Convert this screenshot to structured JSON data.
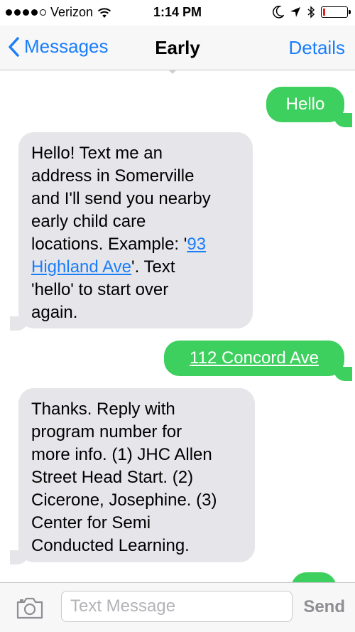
{
  "status_bar": {
    "carrier": "Verizon",
    "time": "1:14 PM",
    "signal_bars": 4,
    "battery_level": 0.1
  },
  "nav": {
    "back_label": "Messages",
    "title": "Early",
    "details_label": "Details"
  },
  "messages": {
    "m1": {
      "text": "Hello"
    },
    "m2": {
      "line1": "Hello! Text me an",
      "line2": "address in Somerville",
      "line3": "and I'll send you nearby",
      "line4": "early child care",
      "line5_pre": "locations. Example: '",
      "line5_link": "93",
      "line6_link": "Highland Ave",
      "line6_post": "'. Text",
      "line7": "'hello' to start over",
      "line8": "again."
    },
    "m3": {
      "text": "112 Concord Ave"
    },
    "m4": {
      "line1": "Thanks. Reply with",
      "line2": "program number for",
      "line3": "more info. (1) JHC Allen",
      "line4": "Street  Head Start. (2)",
      "line5": "Cicerone, Josephine. (3)",
      "line6": "Center for Semi",
      "line7": "Conducted Learning."
    }
  },
  "input_bar": {
    "placeholder": "Text Message",
    "send_label": "Send"
  },
  "colors": {
    "accent": "#1a7efb",
    "outgoing_bubble": "#3ed05f",
    "incoming_bubble": "#e5e5ea"
  },
  "icons": {
    "wifi": "wifi-icon",
    "moon": "moon-icon",
    "location": "location-arrow-icon",
    "bluetooth": "bluetooth-icon",
    "battery": "battery-icon",
    "back": "chevron-left-icon",
    "camera": "camera-icon"
  }
}
